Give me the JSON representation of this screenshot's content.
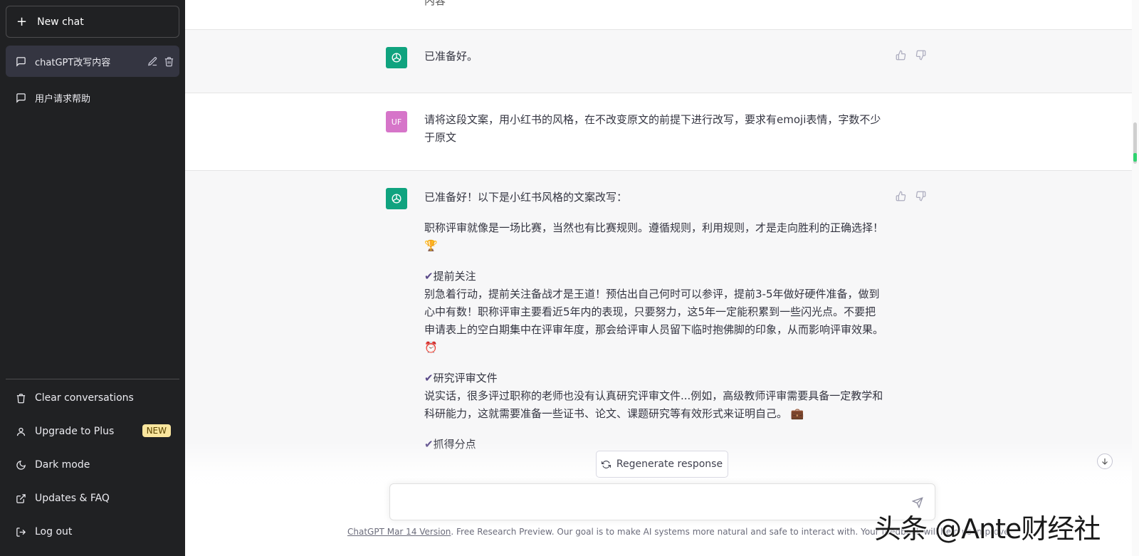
{
  "sidebar": {
    "new_chat_label": "New chat",
    "conversations": [
      {
        "title": "chatGPT改写内容"
      },
      {
        "title": "用户请求帮助"
      }
    ],
    "bottom": {
      "clear": "Clear conversations",
      "upgrade": "Upgrade to Plus",
      "upgrade_badge": "NEW",
      "dark_mode": "Dark mode",
      "updates": "Updates & FAQ",
      "logout": "Log out"
    }
  },
  "chat": {
    "top_cut_text": "内容",
    "messages": [
      {
        "role": "assistant",
        "text": "已准备好。"
      },
      {
        "role": "user",
        "avatar": "UF",
        "text": "请将这段文案，用小红书的风格，在不改变原文的前提下进行改写，要求有emoji表情，字数不少于原文"
      },
      {
        "role": "assistant",
        "intro": "已准备好！以下是小红书风格的文案改写：",
        "para1": "职称评审就像是一场比赛，当然也有比赛规则。遵循规则，利用规则，才是走向胜利的正确选择！ 🏆",
        "s1_title": "提前关注",
        "s1_body": "别急着行动，提前关注备战才是王道！预估出自己何时可以参评，提前3-5年做好硬件准备，做到心中有数！职称评审主要看近5年内的表现，只要努力，这5年一定能积累到一些闪光点。不要把申请表上的空白期集中在评审年度，那会给评审人员留下临时抱佛脚的印象，从而影响评审效果。 ⏰",
        "s2_title": "研究评审文件",
        "s2_body": "说实话，很多评过职称的老师也没有认真研究评审文件...例如，高级教师评审需要具备一定教学和科研能力，这就需要准备一些证书、论文、课题研究等有效形式来证明自己。 💼",
        "s3_title": "抓得分点"
      }
    ]
  },
  "regenerate_label": "Regenerate response",
  "footer": {
    "version_link": "ChatGPT Mar 14 Version",
    "note": ". Free Research Preview. Our goal is to make AI systems more natural and safe to interact with. Your feedback will help us improve."
  },
  "watermark": "头条 @Ante财经社"
}
